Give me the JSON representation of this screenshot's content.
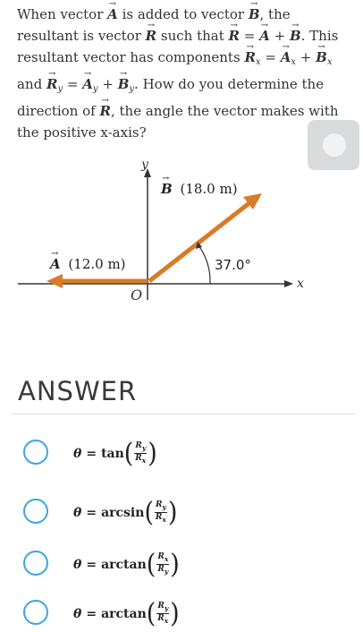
{
  "question": {
    "p1": "When vector",
    "A": "A",
    "p2": "is added to vector",
    "B": "B",
    "p3": ", the resultant is vector",
    "R": "R",
    "p4": "such that",
    "eq_sum": "= A + B",
    "p5": ". This resultant vector has components",
    "Rx": "R",
    "x": "x",
    "eq_x": "= A",
    "eq_x2": "+ B",
    "and": "and",
    "Ry": "R",
    "y": "y",
    "eq_y": "= A",
    "eq_y2": "+ B",
    "p6": ". How do you determine the direction of",
    "p7": ", the angle the vector makes with the positive x-axis?"
  },
  "diagram": {
    "y_axis_label": "y",
    "x_axis_label": "x",
    "origin_label": "O",
    "vector_b_label": "B",
    "vector_b_magnitude": "(18.0 m)",
    "vector_a_label": "A",
    "vector_a_magnitude": "(12.0 m)",
    "angle_label": "37.0°",
    "arrow_color": "#d97b27"
  },
  "answer": {
    "title": "ANSWER",
    "options": [
      {
        "theta": "θ",
        "eq": "=",
        "fn": "tan",
        "num": "R",
        "num_sub": "y",
        "den": "R",
        "den_sub": "x"
      },
      {
        "theta": "θ",
        "eq": "=",
        "fn": "arcsin",
        "num": "R",
        "num_sub": "y",
        "den": "R",
        "den_sub": "x"
      },
      {
        "theta": "θ",
        "eq": "=",
        "fn": "arctan",
        "num": "R",
        "num_sub": "x",
        "den": "R",
        "den_sub": "y"
      },
      {
        "theta": "θ",
        "eq": "=",
        "fn": "arctan",
        "num": "R",
        "num_sub": "y",
        "den": "R",
        "den_sub": "x"
      }
    ]
  },
  "colors": {
    "radio_border": "#3ea3e6",
    "toggle_bg": "#d9dadb"
  }
}
